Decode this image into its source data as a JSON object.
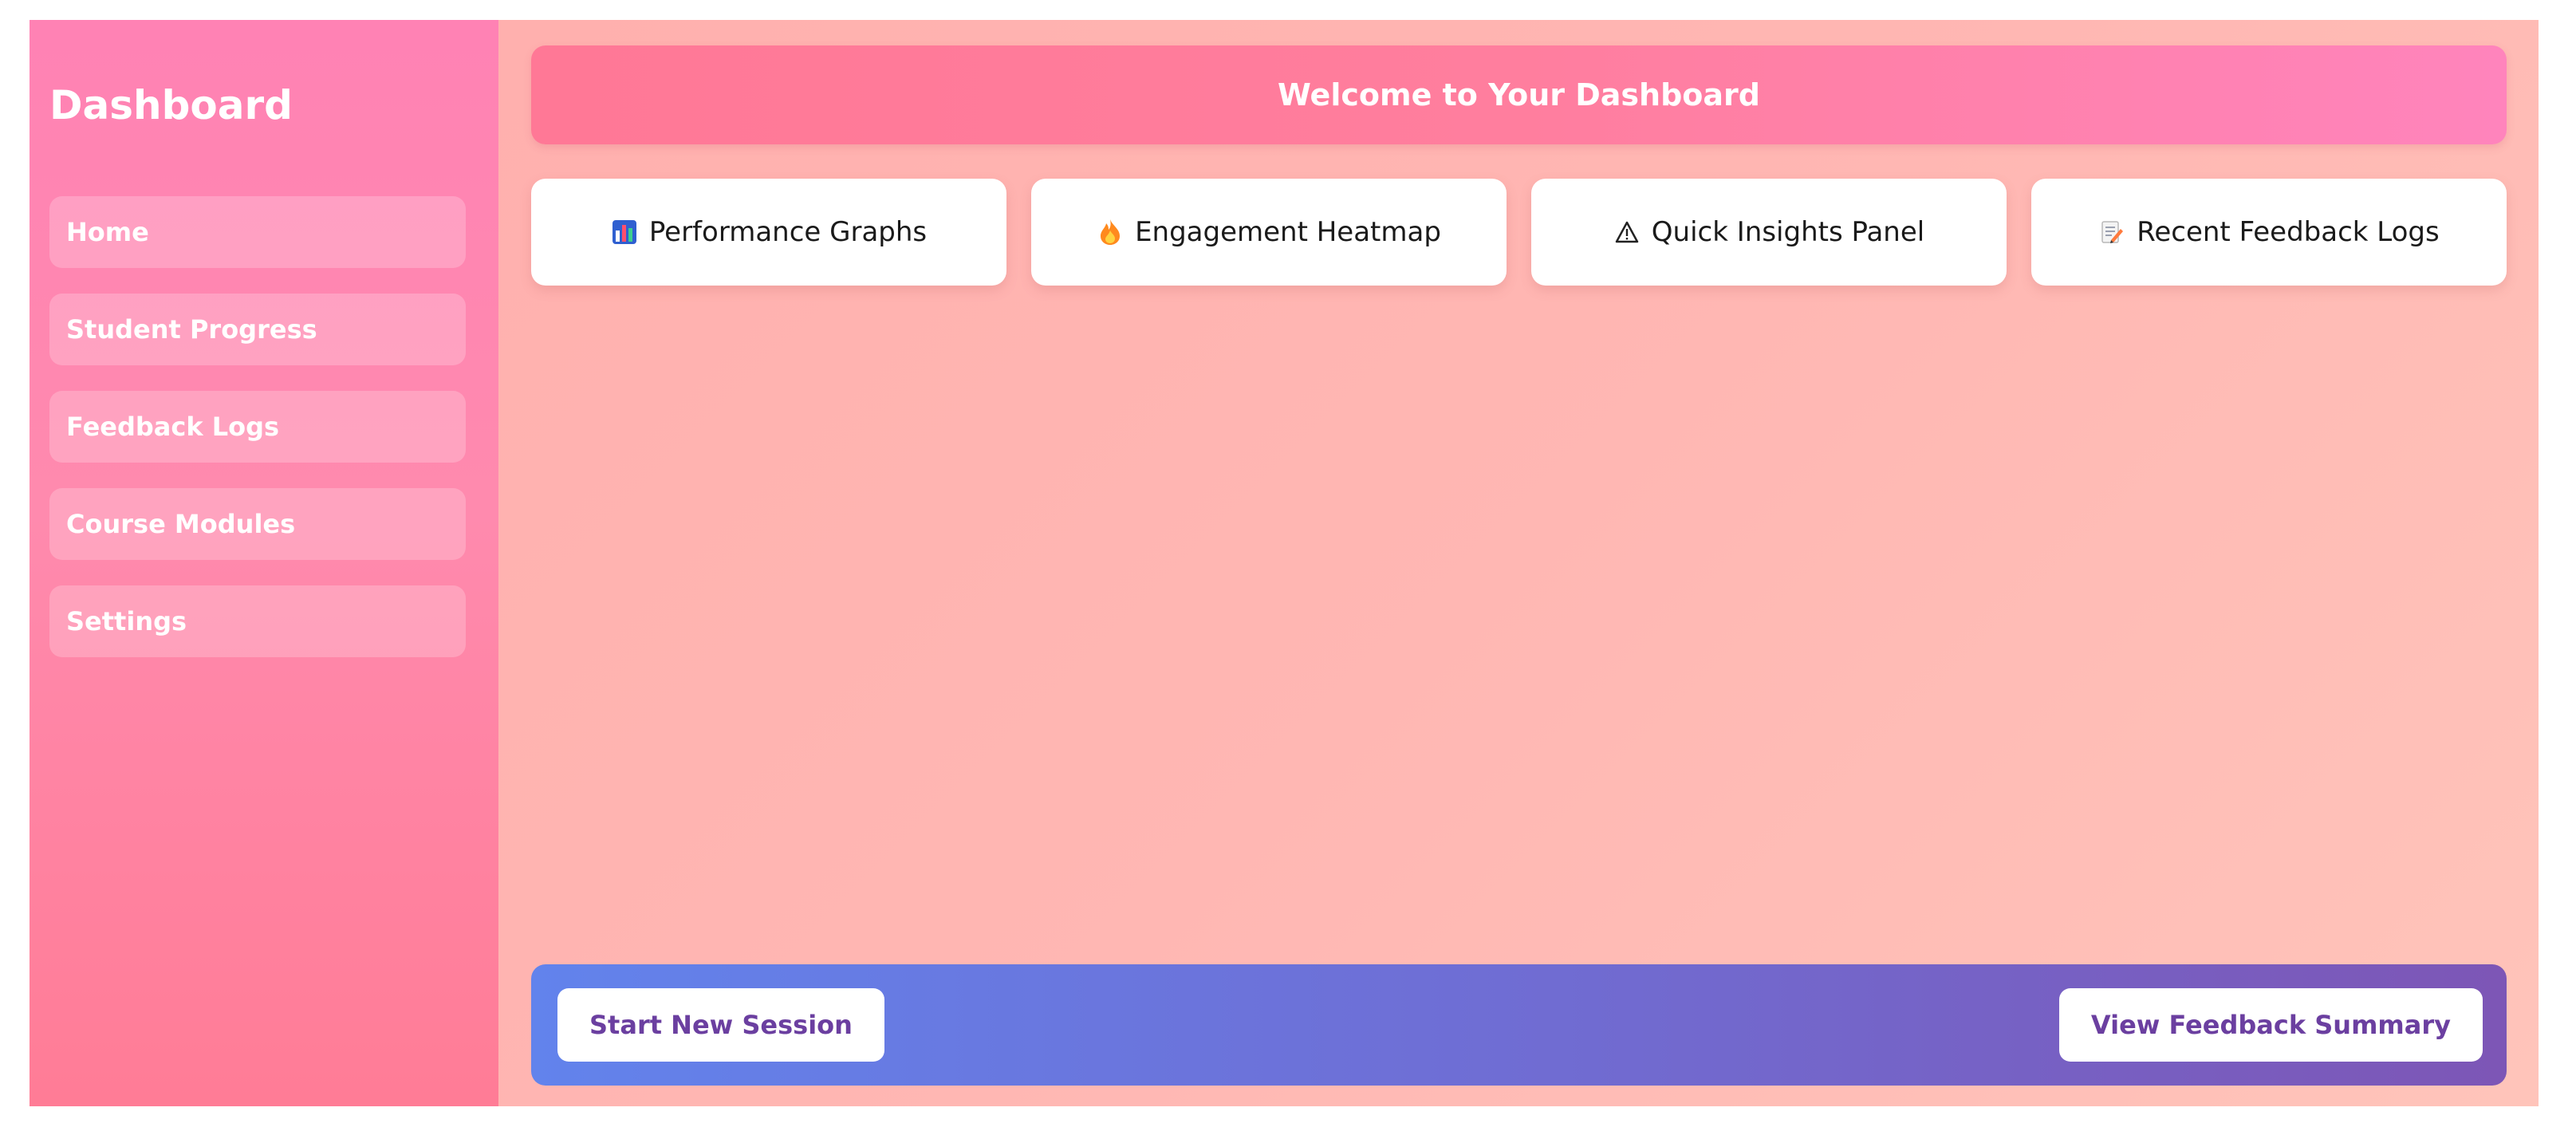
{
  "sidebar": {
    "title": "Dashboard",
    "items": [
      {
        "label": "Home"
      },
      {
        "label": "Student Progress"
      },
      {
        "label": "Feedback Logs"
      },
      {
        "label": "Course Modules"
      },
      {
        "label": "Settings"
      }
    ]
  },
  "header": {
    "title": "Welcome to Your Dashboard"
  },
  "cards": [
    {
      "label": "Performance Graphs",
      "icon": "bar-chart-icon"
    },
    {
      "label": "Engagement Heatmap",
      "icon": "fire-icon"
    },
    {
      "label": "Quick Insights Panel",
      "icon": "warning-icon"
    },
    {
      "label": "Recent Feedback Logs",
      "icon": "memo-icon"
    }
  ],
  "footer": {
    "start_label": "Start New Session",
    "summary_label": "View Feedback Summary"
  },
  "colors": {
    "sidebar": "#ff82b4",
    "header": "#ff7e9e",
    "footer_start": "#6283ec",
    "footer_end": "#7d56b6",
    "button_text": "#6b3fa0"
  }
}
